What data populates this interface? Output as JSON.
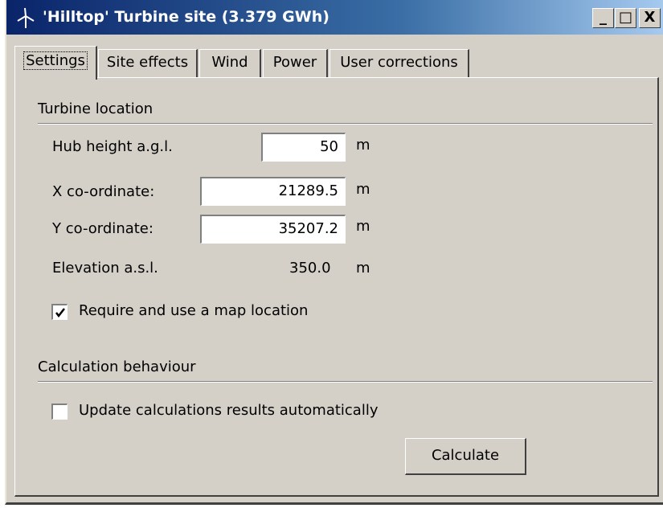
{
  "window": {
    "title": "'Hilltop' Turbine site (3.379 GWh)",
    "icon": "wind-turbine-icon",
    "controls": {
      "minimize": "_",
      "maximize": "□",
      "close": "X"
    }
  },
  "tabs": [
    {
      "label": "Settings",
      "active": true
    },
    {
      "label": "Site effects",
      "active": false
    },
    {
      "label": "Wind",
      "active": false
    },
    {
      "label": "Power",
      "active": false
    },
    {
      "label": "User corrections",
      "active": false
    }
  ],
  "turbine_location": {
    "heading": "Turbine location",
    "hub_height": {
      "label": "Hub height a.g.l.",
      "value": "50",
      "unit": "m"
    },
    "x_coord": {
      "label": "X co-ordinate:",
      "value": "21289.5",
      "unit": "m"
    },
    "y_coord": {
      "label": "Y co-ordinate:",
      "value": "35207.2",
      "unit": "m"
    },
    "elevation": {
      "label": "Elevation a.s.l.",
      "value": "350.0",
      "unit": "m"
    },
    "map_location": {
      "label": "Require and use a map location",
      "checked": true
    }
  },
  "calculation": {
    "heading": "Calculation behaviour",
    "auto_update": {
      "label": "Update calculations results automatically",
      "checked": false
    },
    "calculate_label": "Calculate"
  }
}
